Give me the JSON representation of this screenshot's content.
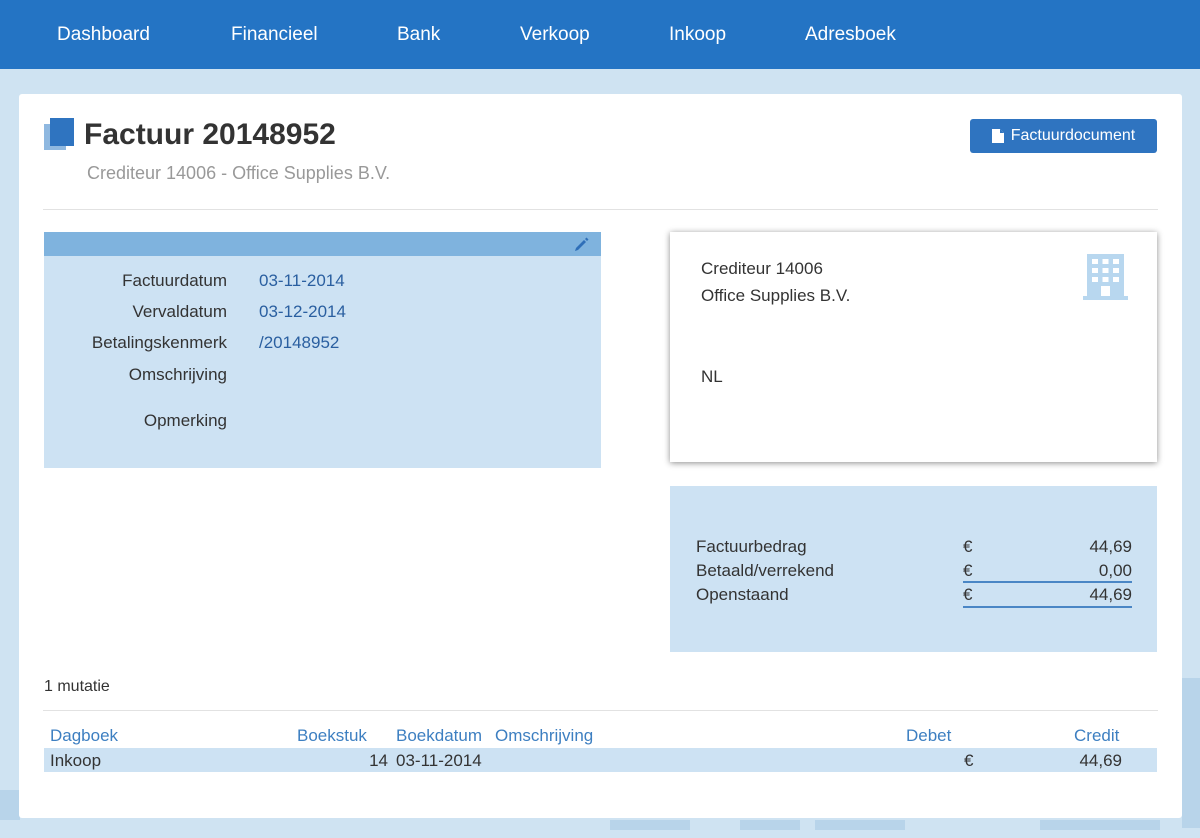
{
  "nav": {
    "items": [
      {
        "label": "Dashboard"
      },
      {
        "label": "Financieel"
      },
      {
        "label": "Bank"
      },
      {
        "label": "Verkoop"
      },
      {
        "label": "Inkoop"
      },
      {
        "label": "Adresboek"
      }
    ]
  },
  "header": {
    "title": "Factuur 20148952",
    "subtitle": "Crediteur 14006 - Office Supplies B.V.",
    "doc_button_label": "Factuurdocument",
    "doc_button_icon": "file-icon",
    "title_icon": "documents-icon"
  },
  "info": {
    "edit_icon": "pencil-icon",
    "rows": [
      {
        "label": "Factuurdatum",
        "value": "03-11-2014"
      },
      {
        "label": "Vervaldatum",
        "value": "03-12-2014"
      },
      {
        "label": "Betalingskenmerk",
        "value": "/20148952"
      },
      {
        "label": "Omschrijving",
        "value": ""
      },
      {
        "label": "Opmerking",
        "value": ""
      }
    ]
  },
  "address": {
    "line1": "Crediteur 14006",
    "line2": "Office Supplies B.V.",
    "country": "NL",
    "icon": "building-icon"
  },
  "amounts": {
    "currency": "€",
    "rows": [
      {
        "label": "Factuurbedrag",
        "value": "44,69"
      },
      {
        "label": "Betaald/verrekend",
        "value": "0,00"
      },
      {
        "label": "Openstaand",
        "value": "44,69"
      }
    ]
  },
  "mutations": {
    "count_label": "1 mutatie",
    "columns": {
      "dagboek": "Dagboek",
      "boekstuk": "Boekstuk",
      "boekdatum": "Boekdatum",
      "omschrijving": "Omschrijving",
      "debet": "Debet",
      "credit": "Credit"
    },
    "rows": [
      {
        "dagboek": "Inkoop",
        "boekstuk": "14",
        "boekdatum": "03-11-2014",
        "omschrijving": "",
        "debet_currency": "€",
        "credit": "44,69"
      }
    ]
  },
  "colors": {
    "navbar": "#2474c4",
    "accent": "#2f74c0",
    "panel": "#cde2f3",
    "panel_header": "#7fb3de"
  }
}
